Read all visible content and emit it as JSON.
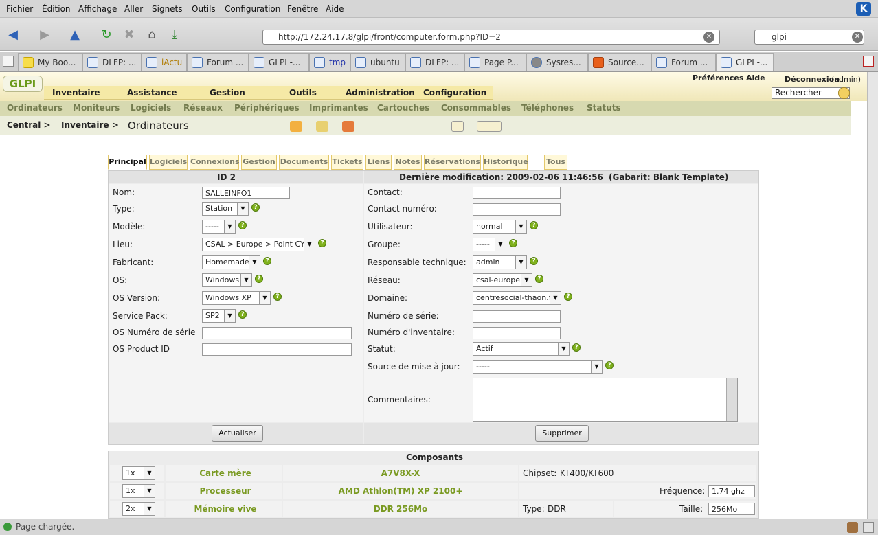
{
  "browser": {
    "menu": [
      "Fichier",
      "Édition",
      "Affichage",
      "Aller",
      "Signets",
      "Outils",
      "Configuration",
      "Fenêtre",
      "Aide"
    ],
    "url": "http://172.24.17.8/glpi/front/computer.form.php?ID=2",
    "search_value": "glpi",
    "tabs": [
      "My Boo...",
      "DLFP: ...",
      "iActu",
      "Forum ...",
      "GLPI -...",
      "tmp",
      "ubuntu",
      "DLFP: ...",
      "Page P...",
      "Sysres...",
      "Source...",
      "Forum ...",
      "GLPI -..."
    ],
    "status": "Page chargée."
  },
  "glpi": {
    "logo": "GLPI",
    "top_links": {
      "preferences": "Préférences",
      "aide": "Aide",
      "deconnexion": "Déconnexion",
      "user": "(admin)"
    },
    "search_value": "Rechercher",
    "main_menu": [
      "Inventaire",
      "Assistance",
      "Gestion",
      "Outils",
      "Administration",
      "Configuration"
    ],
    "sub_menu": [
      "Ordinateurs",
      "Moniteurs",
      "Logiciels",
      "Réseaux",
      "Périphériques",
      "Imprimantes",
      "Cartouches",
      "Consommables",
      "Téléphones",
      "Statuts"
    ],
    "breadcrumb": {
      "central": "Central >",
      "inventaire": "Inventaire >",
      "page": "Ordinateurs"
    },
    "form_tabs": [
      "Principal",
      "Logiciels",
      "Connexions",
      "Gestion",
      "Documents",
      "Tickets",
      "Liens",
      "Notes",
      "Réservations",
      "Historique",
      "Tous"
    ]
  },
  "form": {
    "id_header": "ID 2",
    "mod_header": "Dernière modification: 2009-02-06 11:46:56",
    "template": "(Gabarit: Blank Template)",
    "left": {
      "nom": {
        "label": "Nom:",
        "value": "SALLEINFO1"
      },
      "type": {
        "label": "Type:",
        "value": "Station"
      },
      "modele": {
        "label": "Modèle:",
        "value": "-----"
      },
      "lieu": {
        "label": "Lieu:",
        "value": "CSAL > Europe > Point CYB"
      },
      "fabricant": {
        "label": "Fabricant:",
        "value": "Homemade"
      },
      "os": {
        "label": "OS:",
        "value": "Windows"
      },
      "os_version": {
        "label": "OS Version:",
        "value": "Windows XP"
      },
      "service_pack": {
        "label": "Service Pack:",
        "value": "SP2"
      },
      "os_serial": {
        "label": "OS Numéro de série",
        "value": ""
      },
      "os_product": {
        "label": "OS Product ID",
        "value": ""
      }
    },
    "right": {
      "contact": {
        "label": "Contact:",
        "value": ""
      },
      "contact_num": {
        "label": "Contact numéro:",
        "value": ""
      },
      "utilisateur": {
        "label": "Utilisateur:",
        "value": "normal"
      },
      "groupe": {
        "label": "Groupe:",
        "value": "-----"
      },
      "responsable": {
        "label": "Responsable technique:",
        "value": "admin"
      },
      "reseau": {
        "label": "Réseau:",
        "value": "csal-europe"
      },
      "domaine": {
        "label": "Domaine:",
        "value": "centresocial-thaon.fr"
      },
      "num_serie": {
        "label": "Numéro de série:",
        "value": ""
      },
      "num_inventaire": {
        "label": "Numéro d'inventaire:",
        "value": ""
      },
      "statut": {
        "label": "Statut:",
        "value": "Actif"
      },
      "source_maj": {
        "label": "Source de mise à jour:",
        "value": "-----"
      },
      "commentaires": {
        "label": "Commentaires:",
        "value": ""
      }
    },
    "update_button": "Actualiser",
    "delete_button": "Supprimer"
  },
  "components": {
    "title": "Composants",
    "rows": [
      {
        "qty": "1x",
        "type": "Carte mère",
        "model": "A7V8X-X",
        "extra_label": "Chipset:",
        "extra_value": "KT400/KT600"
      },
      {
        "qty": "1x",
        "type": "Processeur",
        "model": "AMD Athlon(TM) XP 2100+",
        "extra_label": "Fréquence:",
        "extra_value": "1.74 ghz"
      },
      {
        "qty": "2x",
        "type": "Mémoire vive",
        "model": "DDR 256Mo",
        "extra_label": "Type:",
        "extra_value": "DDR",
        "extra_label2": "Taille:",
        "extra_value2": "256Mo"
      }
    ]
  },
  "colors": {
    "glpi_green": "#7a9a22",
    "menu_yellow": "#f5e9a6",
    "submenu": "#d7d9b0",
    "tab_border": "#e3c86b"
  }
}
